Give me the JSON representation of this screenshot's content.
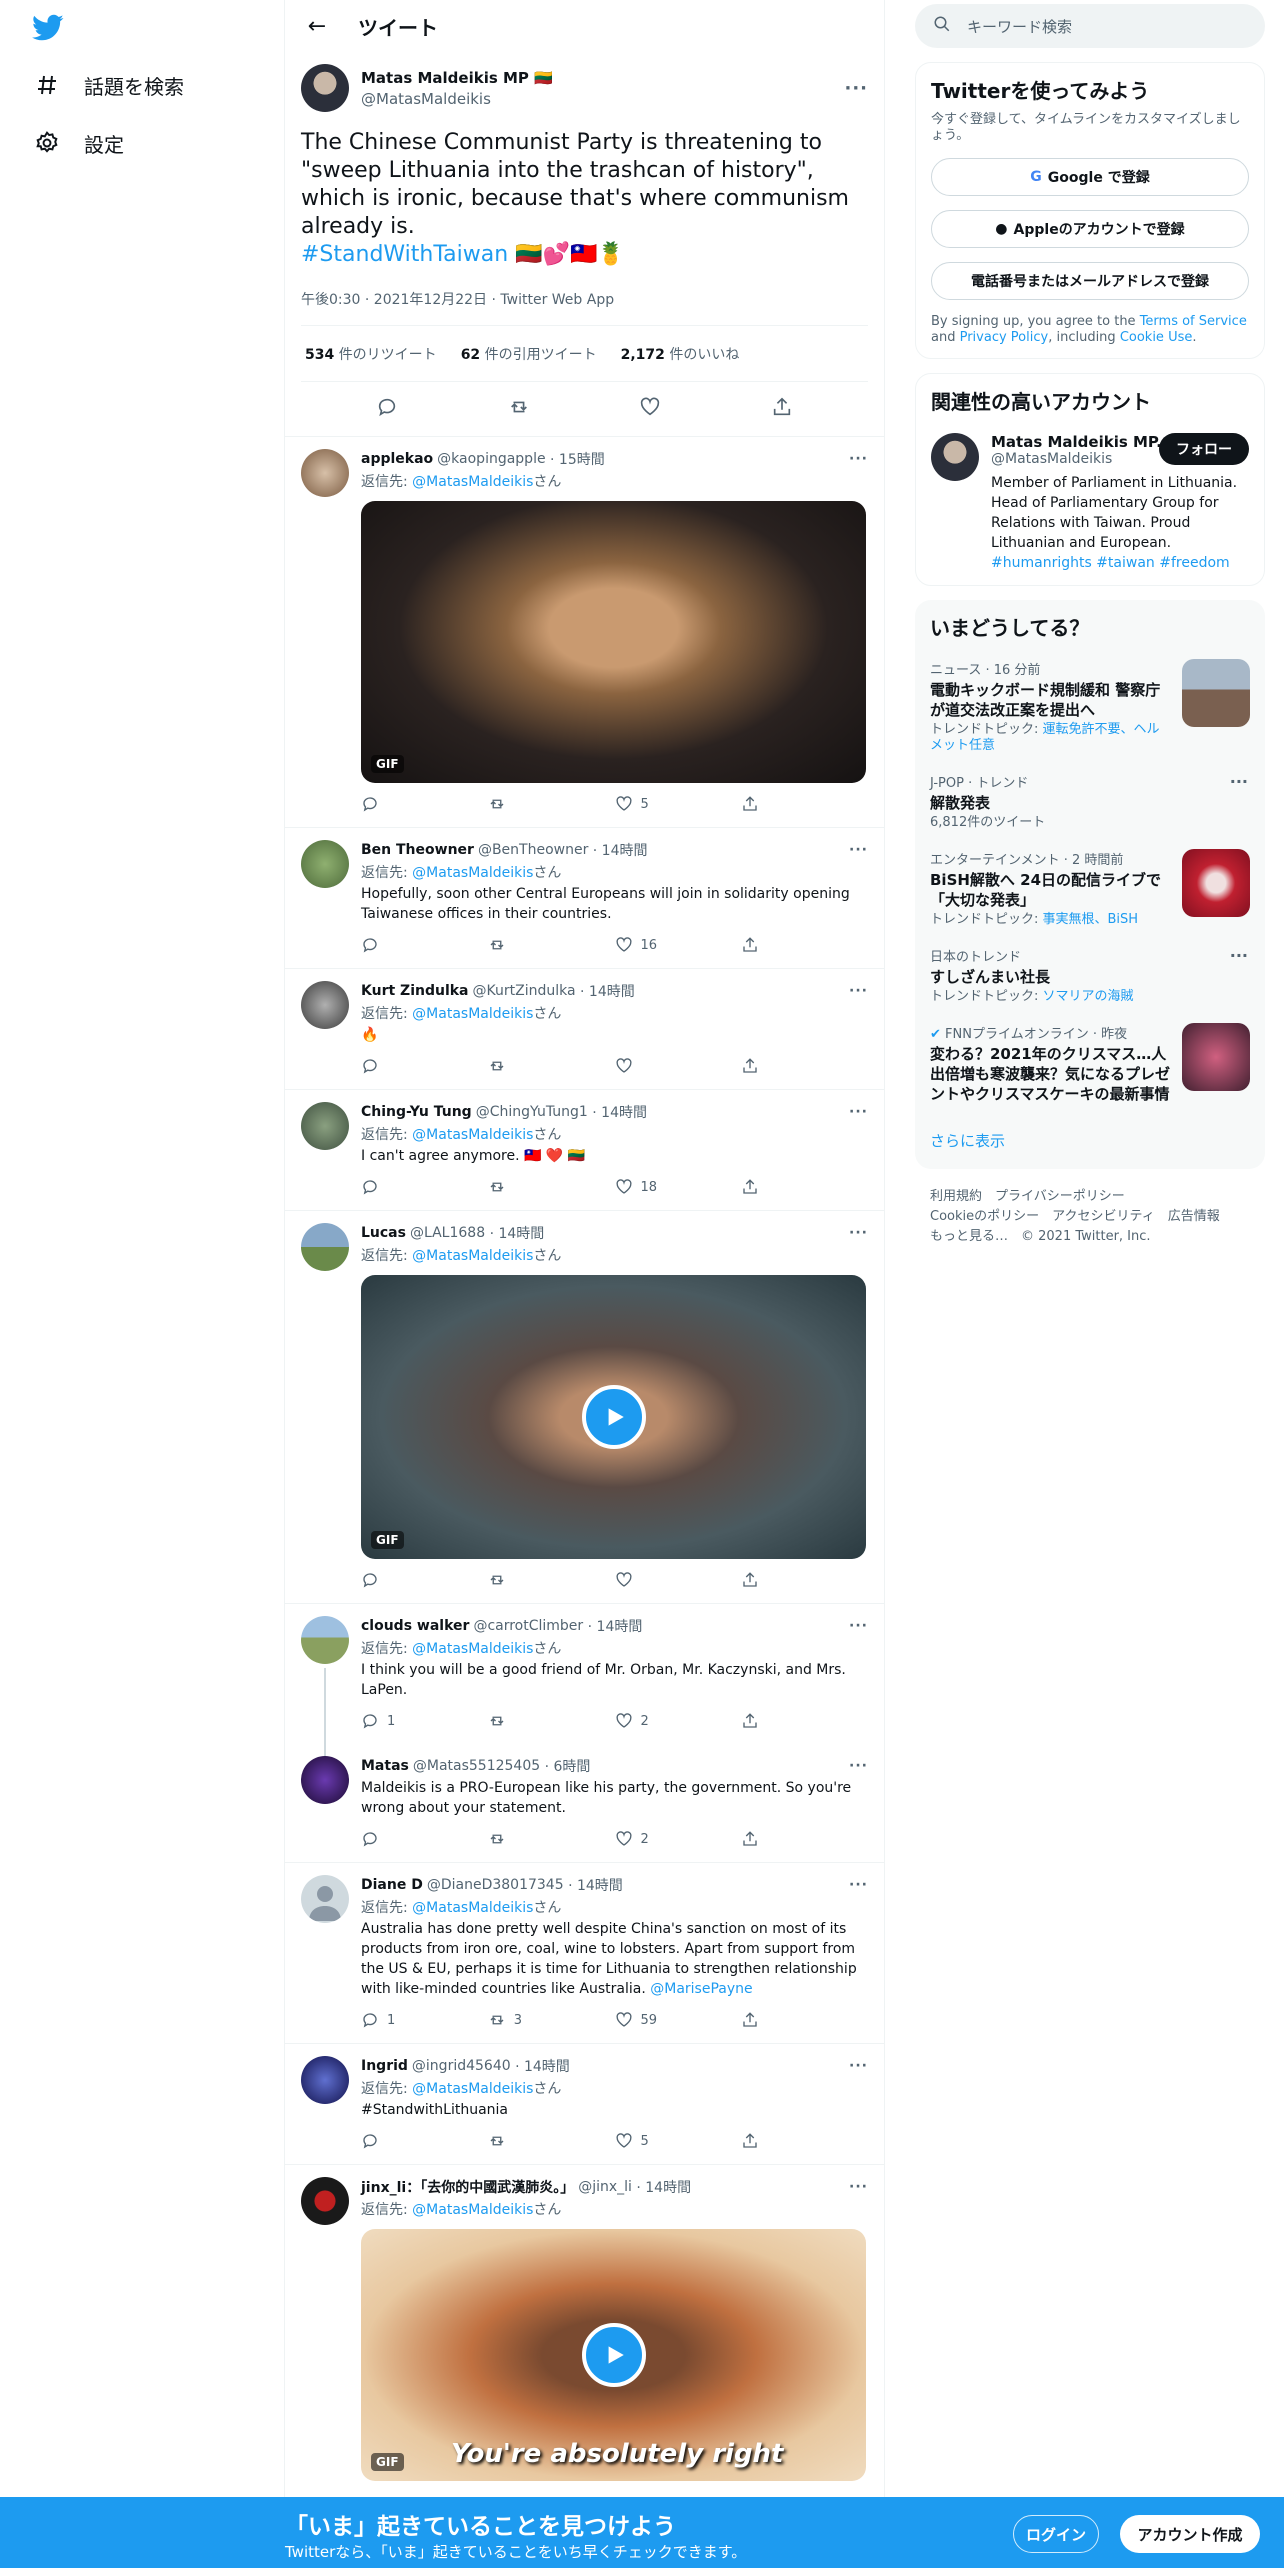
{
  "nav": {
    "explore_label": "話題を検索",
    "settings_label": "設定"
  },
  "header": {
    "title": "ツイート"
  },
  "tweet": {
    "name": "Matas Maldeikis MP 🇱🇹",
    "handle": "@MatasMaldeikis",
    "text": "The Chinese Communist Party is threatening to \"sweep Lithuania into the trashcan of history\", which is ironic, because that's where communism already is.",
    "hashtag": "#StandWithTaiwan",
    "emojis": "🇱🇹💕🇹🇼🍍",
    "time": "午後0:30 · 2021年12月22日 · Twitter Web App",
    "retweets_count": "534",
    "retweets_label": "件のリツイート",
    "quotes_count": "62",
    "quotes_label": "件の引用ツイート",
    "likes_count": "2,172",
    "likes_label": "件のいいね"
  },
  "reply_to_prefix": "返信先: ",
  "reply_to_suffix": "さん",
  "replies": [
    {
      "name": "applekao",
      "handle": "@kaopingapple",
      "time": "· 15時間",
      "to": "@MatasMaldeikis",
      "text": "",
      "media": "gif",
      "media_caption": "",
      "replies": "",
      "retweets": "",
      "likes": "5"
    },
    {
      "name": "Ben Theowner",
      "handle": "@BenTheowner",
      "time": "· 14時間",
      "to": "@MatasMaldeikis",
      "text": "Hopefully, soon other Central Europeans will join in solidarity opening Taiwanese offices in their countries.",
      "replies": "",
      "retweets": "",
      "likes": "16"
    },
    {
      "name": "Kurt Zindulka",
      "handle": "@KurtZindulka",
      "time": "· 14時間",
      "to": "@MatasMaldeikis",
      "text": "🔥",
      "replies": "",
      "retweets": "",
      "likes": ""
    },
    {
      "name": "Ching-Yu Tung",
      "handle": "@ChingYuTung1",
      "time": "· 14時間",
      "to": "@MatasMaldeikis",
      "text": "I can't agree anymore. 🇹🇼 ❤️ 🇱🇹",
      "replies": "",
      "retweets": "",
      "likes": "18"
    },
    {
      "name": "Lucas",
      "handle": "@LAL1688",
      "time": "· 14時間",
      "to": "@MatasMaldeikis",
      "text": "",
      "media": "gif",
      "replies": "",
      "retweets": "",
      "likes": ""
    },
    {
      "name": "clouds walker",
      "handle": "@carrotClimber",
      "time": "· 14時間",
      "to": "@MatasMaldeikis",
      "text": "I think you will be a good friend of Mr. Orban, Mr. Kaczynski, and Mrs. LaPen.",
      "replies": "1",
      "retweets": "",
      "likes": "2"
    },
    {
      "name": "Matas",
      "handle": "@Matas55125405",
      "time": "· 6時間",
      "to": "",
      "text": "Maldeikis is a PRO-European like his party, the government. So you're wrong about your statement.",
      "replies": "",
      "retweets": "",
      "likes": "2"
    },
    {
      "name": "Diane D",
      "handle": "@DianeD38017345",
      "time": "· 14時間",
      "to": "@MatasMaldeikis",
      "text": "Australia has done pretty well despite China's sanction on most of its products from iron ore, coal, wine to lobsters. Apart from support from the US & EU, perhaps it is time for Lithuania to strengthen relationship with like-minded countries like Australia.",
      "mention": "@MarisePayne",
      "replies": "1",
      "retweets": "3",
      "likes": "59"
    },
    {
      "name": "Ingrid",
      "handle": "@ingrid45640",
      "time": "· 14時間",
      "to": "@MatasMaldeikis",
      "hashtag": "#StandwithLithuania",
      "text": "",
      "replies": "",
      "retweets": "",
      "likes": "5"
    },
    {
      "name": "jinx_li：「去你的中國武漢肺炎。」",
      "handle": "@jinx_li",
      "time": "· 14時間",
      "to": "@MatasMaldeikis",
      "text": "",
      "media": "gif",
      "media_caption": "You're absolutely right"
    }
  ],
  "gif_label": "GIF",
  "sidebar": {
    "search_placeholder": "キーワード検索",
    "signup_title": "Twitterを使ってみよう",
    "signup_sub": "今すぐ登録して、タイムラインをカスタマイズしましょう。",
    "google_btn": "Google で登録",
    "apple_btn": "Appleのアカウントで登録",
    "phone_btn": "電話番号またはメールアドレスで登録",
    "terms_prefix": "By signing up, you agree to the ",
    "terms_link": "Terms of Service",
    "terms_and": " and ",
    "privacy_link": "Privacy Policy",
    "terms_including": ", including ",
    "cookie_link": "Cookie Use",
    "terms_end": ".",
    "related_title": "関連性の高いアカウント",
    "related_name": "Matas Maldeikis MP...",
    "related_handle": "@MatasMaldeikis",
    "follow_btn": "フォロー",
    "related_bio": "Member of Parliament in Lithuania. Head of Parliamentary Group for Relations with Taiwan. Proud Lithuanian and European.",
    "related_tags": "#humanrights #taiwan #freedom",
    "trends_title": "いまどうしてる？",
    "trends": [
      {
        "cat": "ニュース · 16 分前",
        "title": "電動キックボード規制緩和 警察庁が道交法改正案を提出へ",
        "sub": "トレンドトピック: ",
        "sublink": "運転免許不要、ヘルメット任意"
      },
      {
        "cat": "J-POP · トレンド",
        "title": "解散発表",
        "sub": "6,812件のツイート",
        "sublink": ""
      },
      {
        "cat": "エンターテインメント · 2 時間前",
        "title": "BiSH解散へ 24日の配信ライブで「大切な発表」",
        "sub": "トレンドトピック: ",
        "sublink": "事実無根、BiSH"
      },
      {
        "cat": "日本のトレンド",
        "title": "すしざんまい社長",
        "sub": "トレンドトピック: ",
        "sublink": "ソマリアの海賊"
      },
      {
        "cat": "FNNプライムオンライン · 昨夜",
        "title": "変わる？2021年のクリスマス…人出倍増も寒波襲来？気になるプレゼントやクリスマスケーキの最新事情",
        "sub": "",
        "sublink": ""
      }
    ],
    "show_more": "さらに表示",
    "footer": {
      "l1": "利用規約　プライバシーポリシー",
      "l2": "Cookieのポリシー　アクセシビリティ　広告情報",
      "l3": "もっと見る…　© 2021 Twitter, Inc."
    }
  },
  "bottombar": {
    "title": "「いま」起きていることを見つけよう",
    "sub": "Twitterなら、「いま」起きていることをいち早くチェックできます。",
    "login": "ログイン",
    "signup": "アカウント作成"
  },
  "colors": {
    "accent": "#1d9bf0",
    "text": "#0f1419",
    "muted": "#536471"
  }
}
